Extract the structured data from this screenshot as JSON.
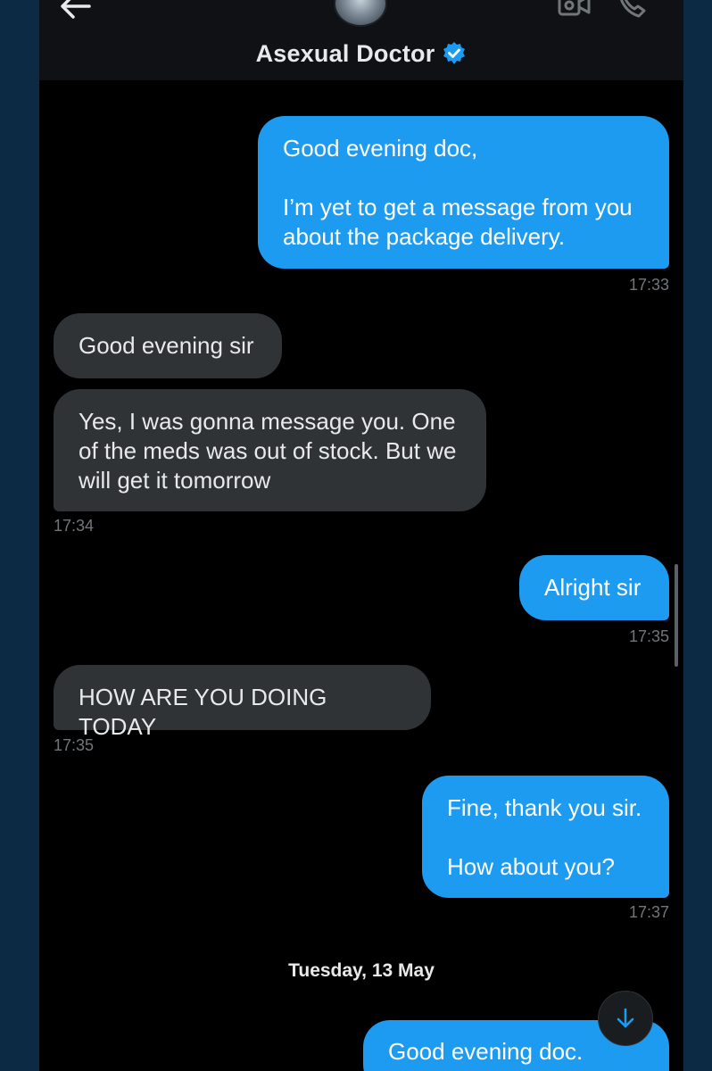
{
  "header": {
    "contact_name": "Asexual Doctor",
    "verified": true,
    "accent_color": "#1d9bf0"
  },
  "icons": {
    "back": "arrow-left-icon",
    "video": "video-camera-icon",
    "call": "phone-icon",
    "verified": "verified-badge-icon",
    "scroll_down": "arrow-down-icon"
  },
  "messages": [
    {
      "direction": "sent",
      "text": "Good evening doc,\n\nI’m yet to get a message from you about the package delivery.",
      "time": "17:33"
    },
    {
      "direction": "received",
      "text": "Good evening sir",
      "time": ""
    },
    {
      "direction": "received",
      "text": "Yes, I was gonna message you. One of the meds was out of stock. But we will get it tomorrow",
      "time": "17:34"
    },
    {
      "direction": "sent",
      "text": "Alright sir",
      "time": "17:35"
    },
    {
      "direction": "received",
      "text": "HOW ARE YOU DOING TODAY",
      "time": "17:35"
    },
    {
      "direction": "sent",
      "text": "Fine, thank you sir.\n\nHow about you?",
      "time": "17:37"
    },
    {
      "direction": "sent",
      "text": "Good evening doc.",
      "time": ""
    }
  ],
  "date_separator": "Tuesday, 13 May"
}
